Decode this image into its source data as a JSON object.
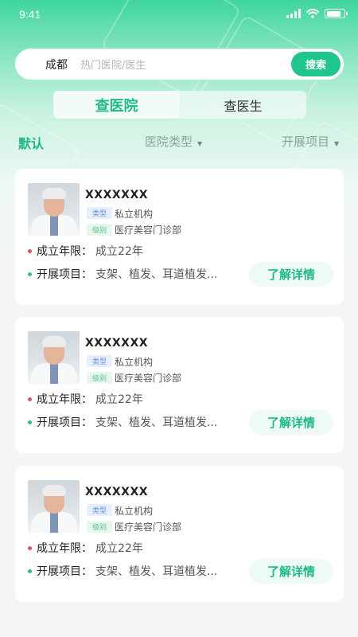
{
  "status_bar": {
    "time": "9:41"
  },
  "search": {
    "city": "成都",
    "placeholder": "热门医院/医生",
    "button_label": "搜索"
  },
  "segment": {
    "tabs": [
      {
        "label": "查医院",
        "active": true
      },
      {
        "label": "查医生",
        "active": false
      }
    ]
  },
  "filters": [
    {
      "label": "默认",
      "active": true
    },
    {
      "label": "医院类型",
      "active": false,
      "caret": "▼"
    },
    {
      "label": "开展项目",
      "active": false,
      "caret": "▼"
    }
  ],
  "cards": [
    {
      "name": "XXXXXXX",
      "type_tag": "类型",
      "type_value": "私立机构",
      "level_tag": "级别",
      "level_value": "医疗美容门诊部",
      "founded_label": "成立年限：",
      "founded_value": "成立22年",
      "projects_label": "开展项目：",
      "projects_value": "支架、植发、耳道植发...",
      "button_label": "了解详情"
    },
    {
      "name": "XXXXXXX",
      "type_tag": "类型",
      "type_value": "私立机构",
      "level_tag": "级别",
      "level_value": "医疗美容门诊部",
      "founded_label": "成立年限：",
      "founded_value": "成立22年",
      "projects_label": "开展项目：",
      "projects_value": "支架、植发、耳道植发...",
      "button_label": "了解详情"
    },
    {
      "name": "XXXXXXX",
      "type_tag": "类型",
      "type_value": "私立机构",
      "level_tag": "级别",
      "level_value": "医疗美容门诊部",
      "founded_label": "成立年限：",
      "founded_value": "成立22年",
      "projects_label": "开展项目：",
      "projects_value": "支架、植发、耳道植发...",
      "button_label": "了解详情"
    }
  ],
  "colors": {
    "accent": "#1fc58f",
    "accent_text": "#1fb985",
    "background": "#f4f5f7"
  }
}
